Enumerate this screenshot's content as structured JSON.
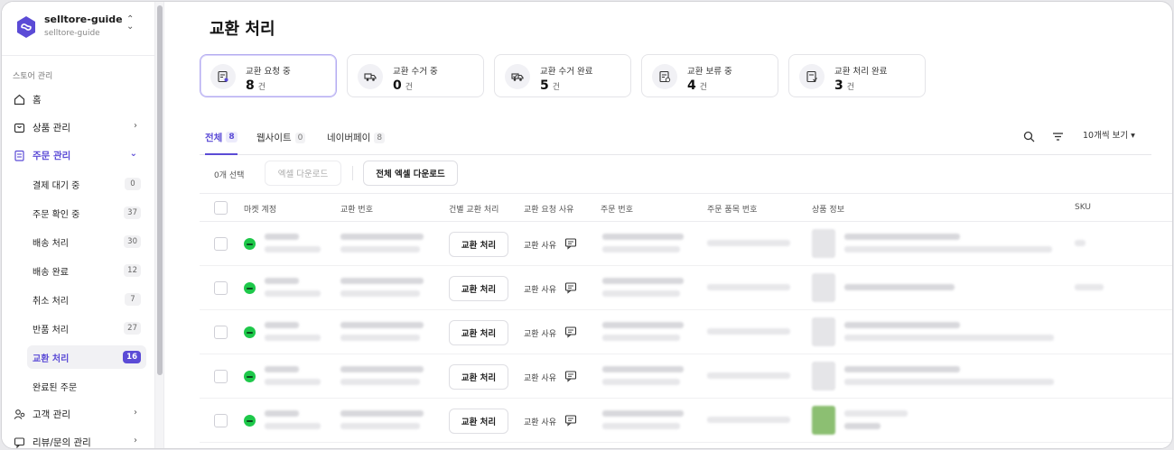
{
  "store": {
    "name": "selltore-guide",
    "id": "selltore-guide"
  },
  "sidebar": {
    "section_label": "스토어 관리",
    "items": [
      {
        "label": "홈",
        "icon": "home-icon"
      },
      {
        "label": "상품 관리",
        "icon": "bag-icon"
      },
      {
        "label": "주문 관리",
        "icon": "clipboard-icon"
      },
      {
        "label": "고객 관리",
        "icon": "users-icon"
      },
      {
        "label": "리뷰/문의 관리",
        "icon": "message-icon"
      }
    ],
    "sub_items": [
      {
        "label": "결제 대기 중",
        "count": "0"
      },
      {
        "label": "주문 확인 중",
        "count": "37"
      },
      {
        "label": "배송 처리",
        "count": "30"
      },
      {
        "label": "배송 완료",
        "count": "12"
      },
      {
        "label": "취소 처리",
        "count": "7"
      },
      {
        "label": "반품 처리",
        "count": "27"
      },
      {
        "label": "교환 처리",
        "count": "16"
      },
      {
        "label": "완료된 주문",
        "count": ""
      }
    ]
  },
  "page": {
    "title": "교환 처리"
  },
  "cards": [
    {
      "label": "교환 요청 중",
      "value": "8",
      "unit": "건"
    },
    {
      "label": "교환 수거 중",
      "value": "0",
      "unit": "건"
    },
    {
      "label": "교환 수거 완료",
      "value": "5",
      "unit": "건"
    },
    {
      "label": "교환 보류 중",
      "value": "4",
      "unit": "건"
    },
    {
      "label": "교환 처리 완료",
      "value": "3",
      "unit": "건"
    }
  ],
  "tabs": [
    {
      "label": "전체",
      "count": "8"
    },
    {
      "label": "웹사이트",
      "count": "0"
    },
    {
      "label": "네이버페이",
      "count": "8"
    }
  ],
  "toolbar": {
    "page_size": "10개씩 보기 ▾",
    "selected_count": "0개 선택",
    "excel_download": "엑셀 다운로드",
    "all_excel_download": "전체 엑셀 다운로드"
  },
  "table": {
    "columns": [
      "마켓 계정",
      "교환 번호",
      "건별 교환 처리",
      "교환 요청 사유",
      "주문 번호",
      "주문 품목 번호",
      "상품 정보",
      "SKU"
    ],
    "rows": [
      {
        "action": "교환 처리",
        "reason": "교환 사유"
      },
      {
        "action": "교환 처리",
        "reason": "교환 사유"
      },
      {
        "action": "교환 처리",
        "reason": "교환 사유"
      },
      {
        "action": "교환 처리",
        "reason": "교환 사유"
      },
      {
        "action": "교환 처리",
        "reason": "교환 사유"
      }
    ]
  }
}
